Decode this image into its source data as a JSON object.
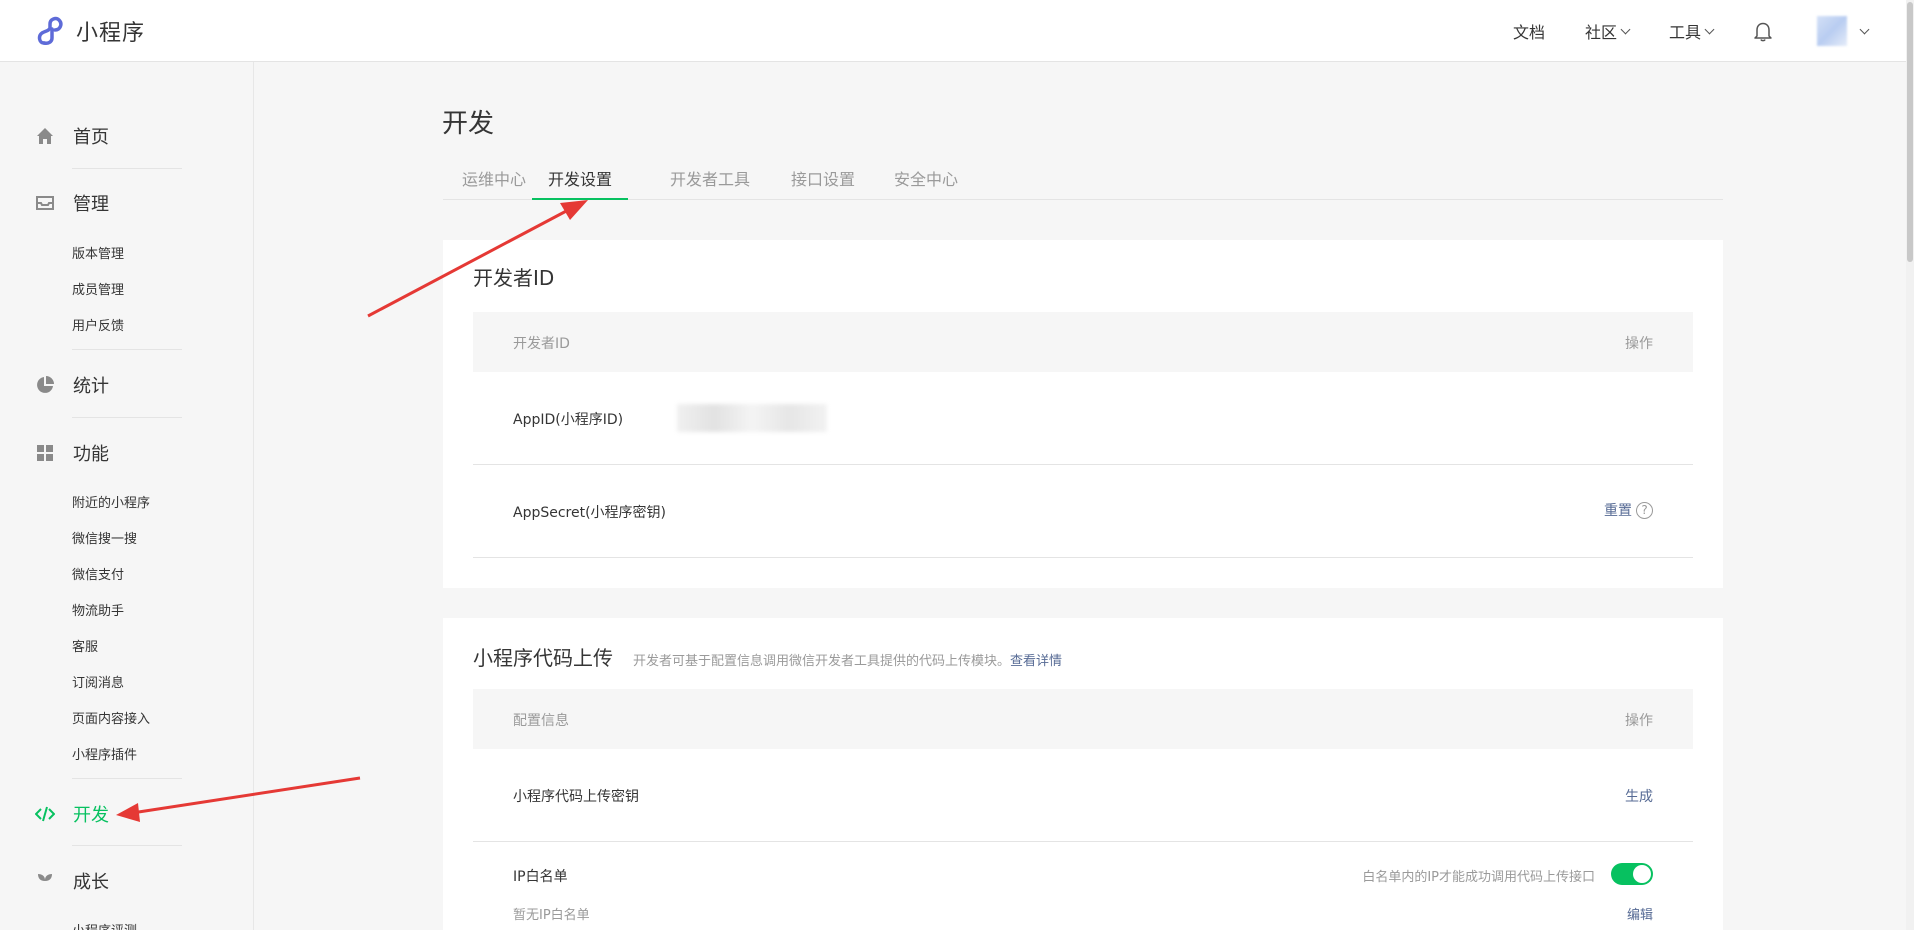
{
  "brand": {
    "name": "小程序",
    "accent": "#07c160",
    "link_color": "#576b95"
  },
  "topnav": {
    "docs": "文档",
    "community": "社区",
    "tools": "工具"
  },
  "sidebar": {
    "home": "首页",
    "manage": "管理",
    "manage_items": [
      "版本管理",
      "成员管理",
      "用户反馈"
    ],
    "stats": "统计",
    "features": "功能",
    "feature_items": [
      "附近的小程序",
      "微信搜一搜",
      "微信支付",
      "物流助手",
      "客服",
      "订阅消息",
      "页面内容接入",
      "小程序插件"
    ],
    "dev": "开发",
    "growth": "成长",
    "growth_items": [
      "小程序评测"
    ]
  },
  "main": {
    "title": "开发",
    "tabs": [
      "运维中心",
      "开发设置",
      "开发者工具",
      "接口设置",
      "安全中心"
    ],
    "active_tab": "开发设置"
  },
  "dev_id_card": {
    "title": "开发者ID",
    "col_left": "开发者ID",
    "col_right": "操作",
    "appid_label": "AppID(小程序ID)",
    "secret_label": "AppSecret(小程序密钥)",
    "reset": "重置",
    "help": "?"
  },
  "upload_card": {
    "title": "小程序代码上传",
    "desc": "开发者可基于配置信息调用微信开发者工具提供的代码上传模块。",
    "detail_link": "查看详情",
    "col_left": "配置信息",
    "col_right": "操作",
    "key_label": "小程序代码上传密钥",
    "generate": "生成",
    "ip_label": "IP白名单",
    "ip_hint": "白名单内的IP才能成功调用代码上传接口",
    "ip_empty": "暂无IP白名单",
    "edit": "编辑",
    "ip_toggle_on": true
  },
  "icons": [
    "logo-icon",
    "home-icon",
    "manage-icon",
    "stats-icon",
    "features-icon",
    "dev-icon",
    "growth-icon",
    "bell-icon"
  ]
}
